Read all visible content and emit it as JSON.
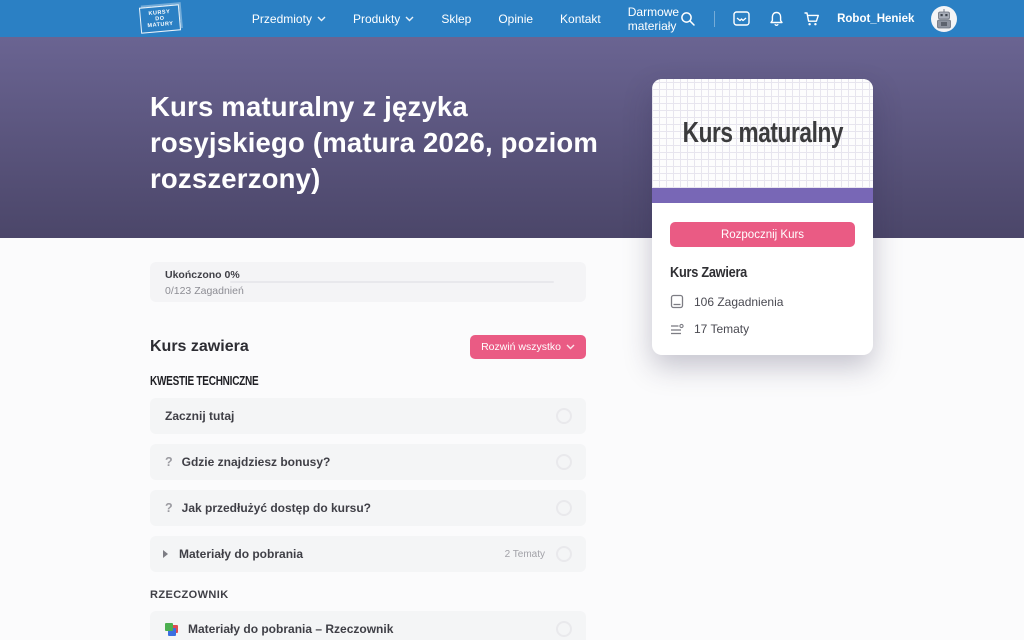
{
  "navbar": {
    "logo": {
      "line1": "KURSY",
      "line2": "DO MATURY"
    },
    "links": [
      {
        "label": "Przedmioty",
        "has_chevron": true
      },
      {
        "label": "Produkty",
        "has_chevron": true
      },
      {
        "label": "Sklep",
        "has_chevron": false
      },
      {
        "label": "Opinie",
        "has_chevron": false
      },
      {
        "label": "Kontakt",
        "has_chevron": false
      },
      {
        "label": "Darmowe materiały",
        "has_chevron": false
      }
    ],
    "username": "Robot_Heniek"
  },
  "hero": {
    "title": "Kurs maturalny z języka rosyjskiego (matura 2026, poziom rozszerzony)"
  },
  "course_card": {
    "title": "Kurs maturalny",
    "start_button_label": "Rozpocznij Kurs",
    "contains_heading": "Kurs Zawiera",
    "meta": [
      {
        "icon": "book-icon",
        "label": "106 Zagadnienia"
      },
      {
        "icon": "list-icon",
        "label": "17 Tematy"
      }
    ]
  },
  "progress": {
    "completed_label": "Ukończono 0%",
    "count_label": "0/123 Zagadnień",
    "percent": 0
  },
  "content": {
    "heading": "Kurs zawiera",
    "expand_all_label": "Rozwiń wszystko",
    "sections": [
      {
        "title": "KWESTIE TECHNICZNE",
        "items": [
          {
            "label": "Zacznij tutaj"
          },
          {
            "label": "Gdzie znajdziesz bonusy?",
            "icon": "question"
          },
          {
            "label": "Jak przedłużyć dostęp do kursu?",
            "icon": "question"
          },
          {
            "label": "Materiały do pobrania",
            "icon": "arrow",
            "badge": "2 Tematy"
          }
        ]
      },
      {
        "title": "RZECZOWNIK",
        "items": [
          {
            "label": "Materiały do pobrania – Rzeczownik",
            "icon": "materials"
          }
        ]
      }
    ]
  },
  "colors": {
    "navbar_blue": "#2b80c4",
    "hero_gradient_top": "#6a6492",
    "hero_gradient_bottom": "#4b4669",
    "accent_pink": "#ea5b84",
    "card_bar_purple": "#7867b6"
  }
}
